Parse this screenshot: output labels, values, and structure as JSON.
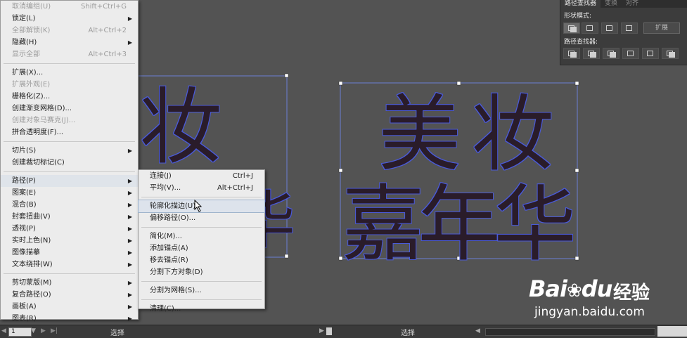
{
  "object_menu": {
    "items": [
      {
        "label": "取消编组(U)",
        "shortcut": "Shift+Ctrl+G",
        "disabled": true
      },
      {
        "label": "锁定(L)",
        "arrow": "▶"
      },
      {
        "label": "全部解锁(K)",
        "shortcut": "Alt+Ctrl+2",
        "disabled": true
      },
      {
        "label": "隐藏(H)",
        "arrow": "▶"
      },
      {
        "label": "显示全部",
        "shortcut": "Alt+Ctrl+3",
        "disabled": true
      },
      {
        "sep": true
      },
      {
        "label": "扩展(X)..."
      },
      {
        "label": "扩展外观(E)",
        "disabled": true
      },
      {
        "label": "栅格化(Z)..."
      },
      {
        "label": "创建渐变网格(D)..."
      },
      {
        "label": "创建对象马赛克(J)...",
        "disabled": true
      },
      {
        "label": "拼合透明度(F)..."
      },
      {
        "sep": true
      },
      {
        "label": "切片(S)",
        "arrow": "▶"
      },
      {
        "label": "创建裁切标记(C)"
      },
      {
        "sep": true
      },
      {
        "label": "路径(P)",
        "arrow": "▶",
        "highlight": true
      },
      {
        "label": "图案(E)",
        "arrow": "▶"
      },
      {
        "label": "混合(B)",
        "arrow": "▶"
      },
      {
        "label": "封套扭曲(V)",
        "arrow": "▶"
      },
      {
        "label": "透视(P)",
        "arrow": "▶"
      },
      {
        "label": "实时上色(N)",
        "arrow": "▶"
      },
      {
        "label": "图像描摹",
        "arrow": "▶"
      },
      {
        "label": "文本绕排(W)",
        "arrow": "▶"
      },
      {
        "sep": true
      },
      {
        "label": "剪切蒙版(M)",
        "arrow": "▶"
      },
      {
        "label": "复合路径(O)",
        "arrow": "▶"
      },
      {
        "label": "画板(A)",
        "arrow": "▶"
      },
      {
        "label": "图表(R)",
        "arrow": "▶"
      }
    ]
  },
  "path_submenu": {
    "items": [
      {
        "label": "连接(J)",
        "shortcut": "Ctrl+J"
      },
      {
        "label": "平均(V)...",
        "shortcut": "Alt+Ctrl+J"
      },
      {
        "sep": true
      },
      {
        "label": "轮廓化描边(U)",
        "highlight": true
      },
      {
        "label": "偏移路径(O)..."
      },
      {
        "sep": true
      },
      {
        "label": "简化(M)..."
      },
      {
        "label": "添加锚点(A)"
      },
      {
        "label": "移去锚点(R)"
      },
      {
        "label": "分割下方对象(D)"
      },
      {
        "sep": true
      },
      {
        "label": "分割为网格(S)..."
      },
      {
        "sep": true
      },
      {
        "label": "清理(C)..."
      }
    ]
  },
  "pathfinder_panel": {
    "tabs": [
      "路径查找器",
      "变换",
      "对齐"
    ],
    "shape_modes_label": "形状模式:",
    "expand_label": "扩展",
    "pathfinders_label": "路径查找器:"
  },
  "artwork": {
    "left_text": "妆",
    "left_partial": "华",
    "right_line1": "美妆",
    "right_line2": "嘉年华"
  },
  "status_bar": {
    "zoom": "1",
    "left_status": "选择",
    "right_status": "选择"
  },
  "watermark": {
    "brand": "Bai",
    "brand2": "du",
    "brand_cn": "经验",
    "url": "jingyan.baidu.com"
  }
}
